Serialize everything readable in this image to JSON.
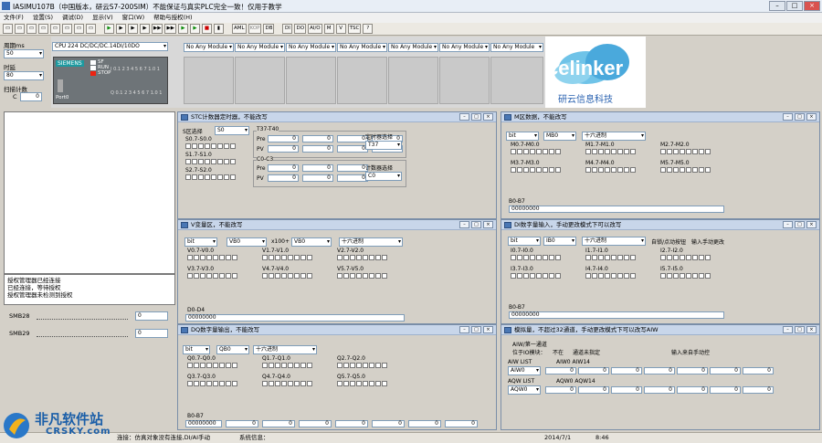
{
  "window": {
    "title": "IASIMU107B（中国版本，研云S7-200SIM）不能保证与真实PLC完全一致！仅用于教学"
  },
  "menu": [
    "文件(F)",
    "设置(S)",
    "调试(D)",
    "显示(V)",
    "窗口(W)",
    "帮助与授权(H)"
  ],
  "toolbar": {
    "buttons": [
      "▶",
      "▶",
      "▶",
      "▶",
      "▶▶",
      "▶▶",
      "▶",
      "▶",
      "■",
      "▮",
      "AML",
      "KOP",
      "DB",
      "DI",
      "DO",
      "AI/O",
      "M",
      "V",
      "TSC",
      "?"
    ]
  },
  "left": {
    "cycle_label": "周期ms",
    "cycle_value": "50",
    "delay_label": "时延",
    "delay_value": "80",
    "scan_label": "扫描计数",
    "scan_value": "0",
    "scan_extra": "C",
    "port": "Port0"
  },
  "plc": {
    "cpu": "CPU 224 DC/DC/DC.14DI/10DO",
    "brand": "SIEMENS",
    "sf": "SF",
    "run": "RUN",
    "stop": "STOP",
    "io_top": "I 0.1 2 3 4 5 6 7 1.0 1",
    "io_bottom": "Q 0.1 2 3 4 5 6 7 1.0 1"
  },
  "modules": [
    "No Any Module",
    "No Any Module",
    "No Any Module",
    "No Any Module",
    "No Any Module",
    "No Any Module",
    "No Any Module"
  ],
  "logo": {
    "name": "celinker",
    "sub": "研云信息科技"
  },
  "log": [
    "授权管理器已经连接",
    "已经连接，等待授权",
    "授权管理器未检测到授权"
  ],
  "smb": {
    "smb28": "SMB28",
    "smb28_val": "0",
    "smb29": "SMB29",
    "smb29_val": "0"
  },
  "panels": {
    "timer": {
      "title": "STC计数器定时器，不能改写",
      "s_label": "S区选择",
      "s_sel": "S0",
      "s_r1": "S0.7-S0.0",
      "s_r2": "S1.7-S1.0",
      "s_r3": "S2.7-S2.0",
      "t_grp": "T37-T40",
      "t_pre": "Pre",
      "t_pv": "PV",
      "t_sel_label": "定时器选择",
      "t_sel": "T37",
      "c_grp": "C0-C3",
      "c_pre": "Pre",
      "c_pv": "PV",
      "c_sel_label": "计数器选择",
      "c_sel": "C0",
      "zero": "0"
    },
    "m": {
      "title": "M区数据，不能改写",
      "type": "bit",
      "area": "MB0",
      "fmt": "十六进制",
      "r1": "M0.7-M0.0",
      "r2": "M1.7-M1.0",
      "r3": "M2.7-M2.0",
      "r4": "M3.7-M3.0",
      "r5": "M4.7-M4.0",
      "r6": "M5.7-M5.0",
      "b_label": "B0-B7",
      "b_val": "00000000",
      "zero": "0"
    },
    "v": {
      "title": "V变量区，不能改写",
      "type": "bit",
      "area": "VB0",
      "mult": "x100+",
      "area2": "VB0",
      "fmt": "十六进制",
      "r1": "V0.7-V0.0",
      "r2": "V1.7-V1.0",
      "r3": "V2.7-V2.0",
      "r4": "V3.7-V3.0",
      "r5": "V4.7-V4.0",
      "r6": "V5.7-V5.0",
      "d_label": "D0-D4",
      "d_val": "00000000"
    },
    "di": {
      "title": "DI数字量输入，手动更改模式下可以改写",
      "type": "bit",
      "area": "IB0",
      "fmt": "十六进制",
      "self": "自锁/点动按钮",
      "manual": "输入手动更改",
      "r1": "I0.7-I0.0",
      "r2": "I1.7-I1.0",
      "r3": "I2.7-I2.0",
      "r4": "I3.7-I3.0",
      "r5": "I4.7-I4.0",
      "r6": "I5.7-I5.0",
      "b_label": "B0-B7",
      "b_val": "00000000",
      "zero": "0"
    },
    "dq": {
      "title": "DQ数字量输出，不能改写",
      "type": "bit",
      "area": "QB0",
      "fmt": "十六进制",
      "r1": "Q0.7-Q0.0",
      "r2": "Q1.7-Q1.0",
      "r3": "Q2.7-Q2.0",
      "r4": "Q3.7-Q3.0",
      "r5": "Q4.7-Q4.0",
      "r6": "Q5.7-Q5.0",
      "b_label": "B0-B7",
      "b_val": "00000000",
      "zero": "0"
    },
    "ai": {
      "title": "模拟量，不超过32通道，手动更改模式下可以改写AIW",
      "ch_label": "AIW/第一通道",
      "pos_label": "位于IO模块：",
      "pos_val": "不在",
      "ch_none": "通道未指定",
      "manual": "输入来自手动控",
      "aiw_list": "AIW LIST",
      "aiw_sel": "AIW0",
      "aiw_range": "AIW0 AIW14",
      "aqw_list": "AQW LIST",
      "aqw_sel": "AQW0",
      "aqw_range": "AQW0 AQW14",
      "zero": "0"
    }
  },
  "status": {
    "s1": "连接：仿真对象没有连接,DI/AI手动",
    "s2": "系统信息：",
    "date": "2014/7/1",
    "time": "8:46"
  },
  "watermark": {
    "cn": "非凡软件站",
    "en": "CRSKY.com"
  }
}
